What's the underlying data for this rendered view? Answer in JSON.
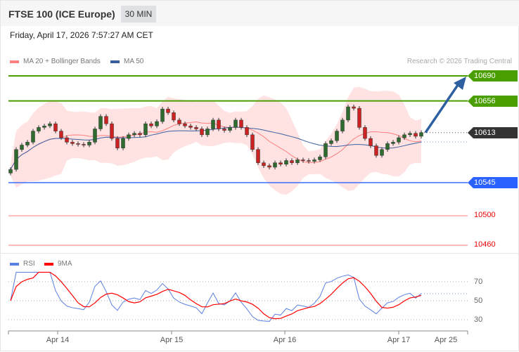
{
  "header": {
    "title": "FTSE 100 (ICE Europe)",
    "timeframe": "30 MIN",
    "datetime": "Friday, April 17, 2026 7:57:27 AM CET"
  },
  "legend": {
    "ma20": "MA 20 + Bollinger Bands",
    "ma50": "MA 50",
    "rsi": "RSI",
    "rsi_ma": "9MA"
  },
  "credit": "Research © 2026 Trading Central",
  "colors": {
    "resistance": "#4a9e00",
    "pivot": "#2962ff",
    "last": "#333333",
    "support": "#ff0000",
    "ma20": "#ff8080",
    "ma50": "#3a5fa0",
    "rsi": "#5b7fe0",
    "rsi_ma": "#ff0000",
    "up": "#2e6b2e",
    "down": "#cc2222"
  },
  "chart_data": {
    "type": "candlestick",
    "ylim": [
      10448,
      10700
    ],
    "levels": {
      "resistance": [
        10690,
        10656
      ],
      "last": 10613,
      "pivot": 10545,
      "support": [
        10500,
        10460
      ]
    },
    "level_labels": {
      "r1": "10690",
      "r2": "10656",
      "last": "10613",
      "pivot": "10545",
      "s1": "10500",
      "s2": "10460"
    },
    "closes": [
      10563,
      10590,
      10596,
      10600,
      10615,
      10620,
      10622,
      10625,
      10615,
      10606,
      10600,
      10598,
      10597,
      10596,
      10600,
      10618,
      10635,
      10625,
      10605,
      10592,
      10605,
      10610,
      10612,
      10610,
      10625,
      10622,
      10628,
      10645,
      10640,
      10630,
      10625,
      10622,
      10620,
      10618,
      10610,
      10618,
      10630,
      10618,
      10616,
      10620,
      10630,
      10620,
      10610,
      10590,
      10572,
      10568,
      10566,
      10572,
      10570,
      10575,
      10572,
      10576,
      10575,
      10574,
      10576,
      10580,
      10598,
      10602,
      10615,
      10630,
      10648,
      10646,
      10620,
      10605,
      10595,
      10582,
      10590,
      10598,
      10600,
      10606,
      10610,
      10612,
      10608,
      10613
    ],
    "forecast_arrow": {
      "from": 10613,
      "to": 10690
    },
    "rsi_levels": [
      "70",
      "50",
      "30"
    ],
    "x_labels": [
      "Apr 14",
      "Apr 15",
      "Apr 16",
      "Apr 17",
      "Apr 25"
    ]
  }
}
